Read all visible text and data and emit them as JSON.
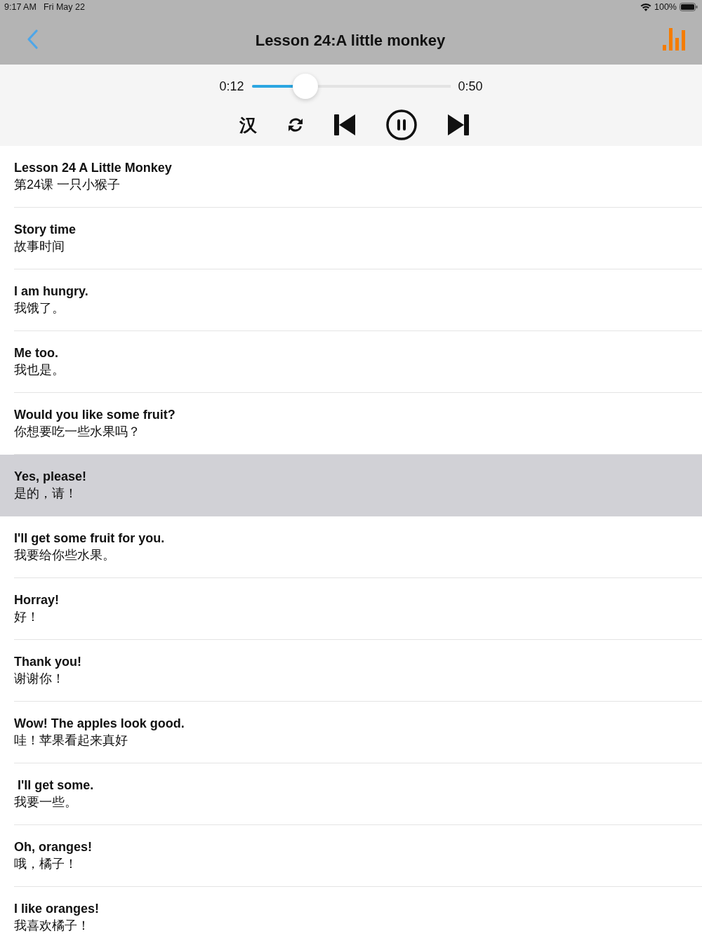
{
  "status_bar": {
    "time": "9:17 AM",
    "date": "Fri May 22",
    "battery": "100%"
  },
  "nav_bar": {
    "title": "Lesson 24:A little monkey"
  },
  "player": {
    "elapsed": "0:12",
    "duration": "0:50",
    "level": 0.27,
    "hanzi_toggle": "汉",
    "playing": true
  },
  "sentences": [
    {
      "english": "Lesson 24 A Little Monkey",
      "chinese": "第24课 一只小猴子",
      "selected": false
    },
    {
      "english": "Story time",
      "chinese": "故事时间",
      "selected": false
    },
    {
      "english": "I am hungry.",
      "chinese": "我饿了。",
      "selected": false
    },
    {
      "english": "Me too.",
      "chinese": "我也是。",
      "selected": false
    },
    {
      "english": "Would you like some fruit?",
      "chinese": "你想要吃一些水果吗？",
      "selected": false
    },
    {
      "english": "Yes, please!",
      "chinese": "是的，请！",
      "selected": true
    },
    {
      "english": "I'll get some fruit for you.",
      "chinese": "我要给你些水果。",
      "selected": false
    },
    {
      "english": "Horray!",
      "chinese": "好！",
      "selected": false
    },
    {
      "english": "Thank you!",
      "chinese": "谢谢你！",
      "selected": false
    },
    {
      "english": "Wow! The apples look good.",
      "chinese": "哇！苹果看起来真好",
      "selected": false
    },
    {
      "english": " I'll get some.",
      "chinese": "我要一些。",
      "selected": false
    },
    {
      "english": "Oh, oranges!",
      "chinese": "哦，橘子！",
      "selected": false
    },
    {
      "english": "I like oranges!",
      "chinese": "我喜欢橘子！",
      "selected": false
    }
  ]
}
